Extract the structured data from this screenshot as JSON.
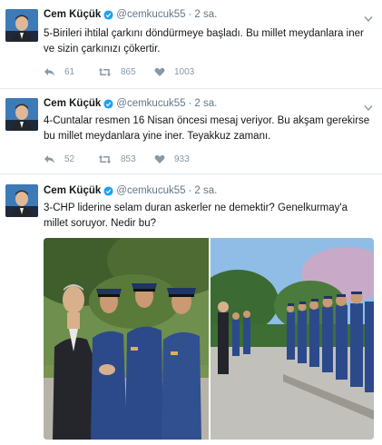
{
  "tweets": [
    {
      "author_name": "Cem Küçük",
      "handle": "@cemkucuk55",
      "separator": "·",
      "time": "2 sa.",
      "text": "5-Birileri ihtilal çarkını döndürmeye başladı. Bu millet meydanlara iner ve sizin çarkınızı çökertir.",
      "replies": "61",
      "retweets": "865",
      "likes": "1003"
    },
    {
      "author_name": "Cem Küçük",
      "handle": "@cemkucuk55",
      "separator": "·",
      "time": "2 sa.",
      "text": "4-Cuntalar resmen 16 Nisan öncesi mesaj veriyor. Bu akşam gerekirse bu millet meydanlara yine iner. Teyakkuz zamanı.",
      "replies": "52",
      "retweets": "853",
      "likes": "933"
    },
    {
      "author_name": "Cem Küçük",
      "handle": "@cemkucuk55",
      "separator": "·",
      "time": "2 sa.",
      "text": "3-CHP liderine selam duran askerler ne demektir? Genelkurmay'a millet soruyor. Nedir bu?"
    }
  ],
  "colors": {
    "verified": "#1da1f2",
    "meta": "#657786",
    "action_icon": "#8899a6",
    "uniform": "#2c4a8a"
  }
}
